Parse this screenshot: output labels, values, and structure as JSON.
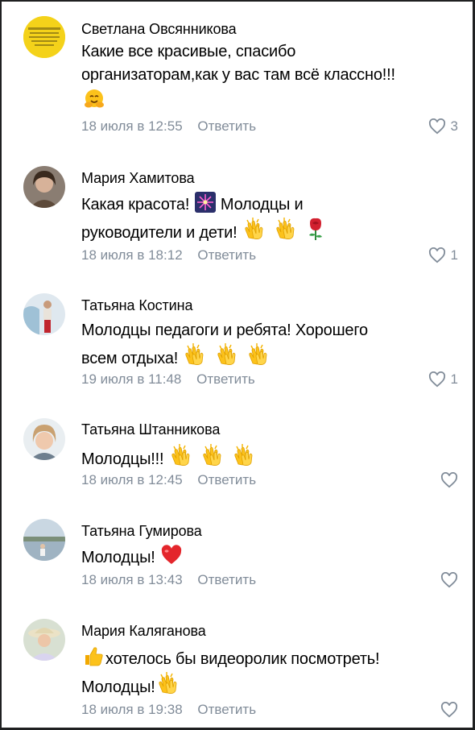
{
  "comments": [
    {
      "author": "Светлана Овсянникова",
      "line1": "Какие все красивые, спасибо",
      "line2": "организаторам,как у вас там всё классно!!!",
      "date": "18 июля в 12:55",
      "reply": "Ответить",
      "likes": "3",
      "emoji": [
        "hugging-face"
      ]
    },
    {
      "author": "Мария Хамитова",
      "line1a": "Какая красота!",
      "line1b": "Молодцы и",
      "line2": "руководители и дети!",
      "date": "18 июля в 18:12",
      "reply": "Ответить",
      "likes": "1",
      "emoji": [
        "firework",
        "clapping-hands",
        "clapping-hands",
        "rose"
      ]
    },
    {
      "author": "Татьяна Костина",
      "line1": "Молодцы педагоги и ребята! Хорошего",
      "line2": "всем отдыха!",
      "date": "19 июля в 11:48",
      "reply": "Ответить",
      "likes": "1",
      "emoji": [
        "clapping-hands",
        "clapping-hands",
        "clapping-hands"
      ]
    },
    {
      "author": "Татьяна Штанникова",
      "line1": "Молодцы!!!",
      "date": "18 июля в 12:45",
      "reply": "Ответить",
      "likes": "",
      "emoji": [
        "clapping-hands",
        "clapping-hands",
        "clapping-hands"
      ]
    },
    {
      "author": "Татьяна Гумирова",
      "line1": "Молодцы!",
      "date": "18 июля в 13:43",
      "reply": "Ответить",
      "likes": "",
      "emoji": [
        "red-heart"
      ]
    },
    {
      "author": "Мария Каляганова",
      "line1": "хотелось бы видеоролик посмотреть!",
      "line2": "Молодцы!",
      "date": "18 июля в 19:38",
      "reply": "Ответить",
      "likes": "",
      "emoji": [
        "thumbs-up",
        "clapping-hands"
      ]
    }
  ],
  "colors": {
    "meta": "#818c99",
    "text": "#000000",
    "background": "#ffffff"
  }
}
